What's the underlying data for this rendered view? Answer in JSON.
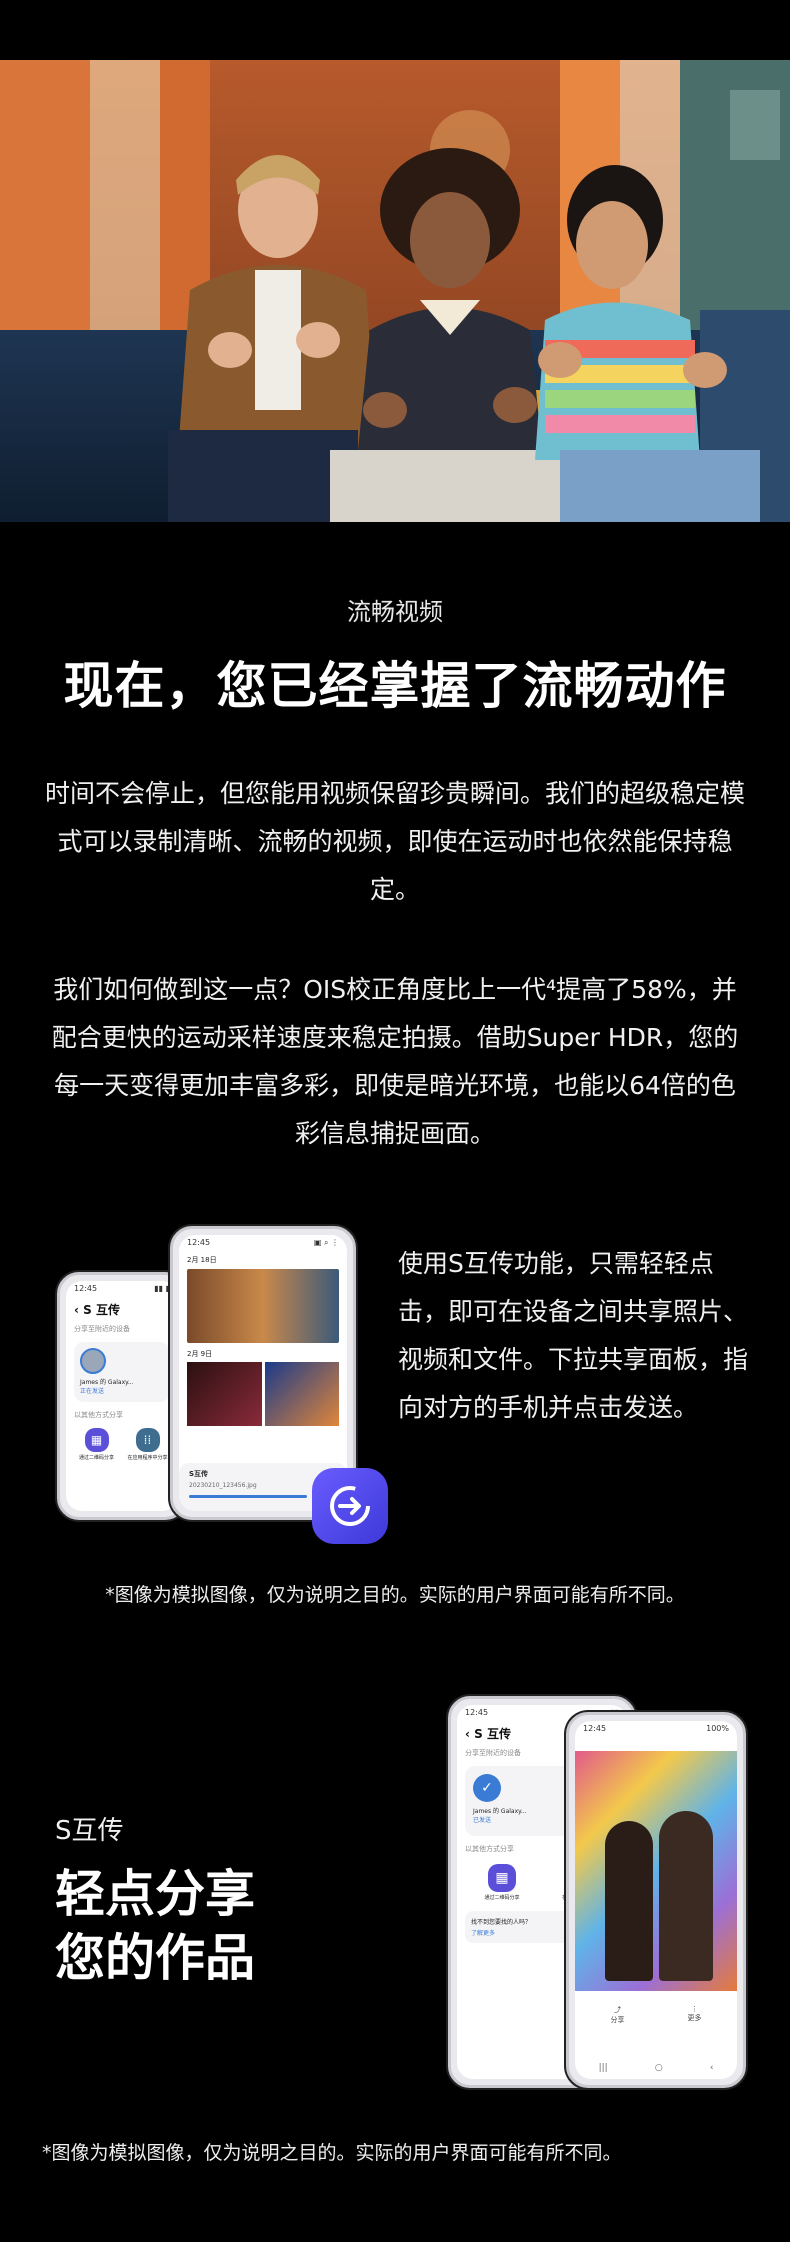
{
  "hero": {
    "alt_icon": "people-on-sofa-photo"
  },
  "section1": {
    "eyebrow": "流畅视频",
    "headline": "现在，您已经掌握了流畅动作",
    "para1": "时间不会停止，但您能用视频保留珍贵瞬间。我们的超级稳定模式可以录制清晰、流畅的视频，即使在运动时也依然能保持稳定。",
    "para2": "我们如何做到这一点？OIS校正角度比上一代⁴提高了58%，并配合更快的运动采样速度来稳定拍摄。借助Super HDR，您的每一天变得更加丰富多彩，即使是暗光环境，也能以64倍的色彩信息捕捉画面。"
  },
  "section2": {
    "share_text": "使用S互传功能，只需轻轻点击，即可在设备之间共享照片、视频和文件。下拉共享面板，指向对方的手机并点击发送。",
    "disclaimer": "*图像为模拟图像，仅为说明之目的。实际的用户界面可能有所不同。",
    "phone_left": {
      "time": "12:45",
      "title": "S 互传",
      "sub1": "分享至附近的设备",
      "contact_name": "James 的 Galaxy...",
      "contact_status": "正在发送",
      "sub2": "以其他方式分享",
      "opt1": "通过二维码分享",
      "opt2": "在应用程序中分享"
    },
    "phone_right": {
      "time": "12:45",
      "date1": "2月 18日",
      "date2": "2月 9日",
      "sheet_title": "S互传",
      "file_name": "20230210_123456.jpg"
    }
  },
  "section3": {
    "label": "S互传",
    "title_line1": "轻点分享",
    "title_line2": "您的作品",
    "disclaimer": "*图像为模拟图像，仅为说明之目的。实际的用户界面可能有所不同。",
    "phone_back": {
      "time": "12:45",
      "title": "S 互传",
      "sub1": "分享至附近的设备",
      "contact_name": "James 的 Galaxy...",
      "contact_status": "已发送",
      "sub2": "以其他方式分享",
      "opt1": "通过二维码分享",
      "opt2": "在应用程序中分享",
      "question": "找不到您要找的人吗？",
      "link": "了解更多"
    },
    "phone_front": {
      "time": "12:45",
      "status_right": "100%",
      "share_label": "分享",
      "more_label": "更多"
    }
  }
}
